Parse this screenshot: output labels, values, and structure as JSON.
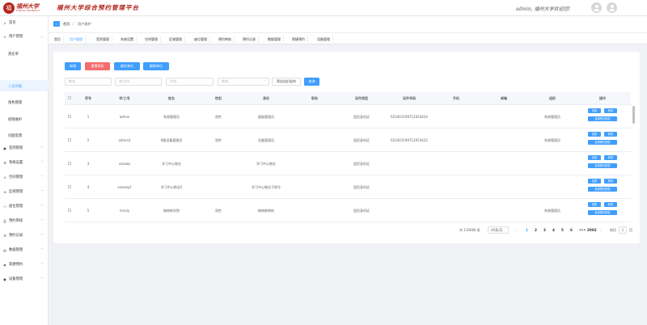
{
  "header": {
    "logo_mark": "福",
    "logo_cn": "福州大学",
    "logo_en": "FUZHOU UNIVERSITY",
    "system_title": "福州大学综合预约管理平台",
    "welcome": "admin, 福州大学欢迎您!"
  },
  "sidebar": {
    "items": [
      {
        "label": "首页",
        "icon": "home-icon"
      },
      {
        "label": "用户管理",
        "icon": "user-icon"
      },
      {
        "label": "签到管理",
        "icon": "person-icon"
      },
      {
        "label": "系统设置",
        "icon": "gear-icon"
      },
      {
        "label": "空间管理",
        "icon": "space-icon"
      },
      {
        "label": "区域管理",
        "icon": "region-icon"
      },
      {
        "label": "座位管理",
        "icon": "seat-icon"
      },
      {
        "label": "预约审核",
        "icon": "audit-icon"
      },
      {
        "label": "预约记录",
        "icon": "record-icon"
      },
      {
        "label": "数据管理",
        "icon": "data-icon"
      },
      {
        "label": "简捷预约",
        "icon": "quick-icon"
      },
      {
        "label": "设备管理",
        "icon": "device-icon"
      }
    ],
    "subitems": [
      "黑名单",
      "人员列表",
      "角色管理",
      "权限维护",
      "问题反馈"
    ]
  },
  "breadcrumb": {
    "home": "首页",
    "sep": "/",
    "current": "用户维护"
  },
  "tabs": [
    "首页",
    "用户管理",
    "签到管理",
    "系统设置",
    "空间管理",
    "区域管理",
    "座位管理",
    "预约审核",
    "预约记录",
    "数据管理",
    "简捷预约",
    "设备管理"
  ],
  "toolbar": {
    "add": "新增",
    "reset_password": "重置密码",
    "bind_org": "绑定单位",
    "unbind_org": "解绑单位"
  },
  "filters": {
    "name_placeholder": "姓名",
    "id_placeholder": "学/工号",
    "phone_placeholder": "手机",
    "gender_placeholder": "性别",
    "org_button": "筛选组织架构",
    "search_button": "查询"
  },
  "table": {
    "headers": [
      "序号",
      "学/工号",
      "姓名",
      "性别",
      "身份",
      "职务",
      "证件类型",
      "证件号码",
      "手机",
      "邮箱",
      "组织",
      "操作"
    ],
    "rows": [
      {
        "no": "1",
        "id": "admin",
        "name": "系统管理员",
        "gender": "男性",
        "role": "超级管理员",
        "title": "",
        "doc_type": "居民身份证",
        "doc_no": "623401199712054424",
        "phone": "",
        "email": "",
        "org": "系统管理员"
      },
      {
        "no": "2",
        "id": "admin2",
        "name": "8楼设备管理员",
        "gender": "男性",
        "role": "设备管理员",
        "title": "",
        "doc_type": "居民身份证",
        "doc_no": "623401199712054422",
        "phone": "",
        "email": "",
        "org": "系统管理员"
      },
      {
        "no": "3",
        "id": "xxzxwy",
        "name": "学习中心物业",
        "gender": "",
        "role": "学习中心物业",
        "title": "",
        "doc_type": "居民身份证",
        "doc_no": "",
        "phone": "",
        "email": "",
        "org": ""
      },
      {
        "no": "4",
        "id": "xxzxwy2",
        "name": "学习中心物业2",
        "gender": "",
        "role": "学习中心物业子账号",
        "title": "",
        "doc_type": "居民身份证",
        "doc_no": "",
        "phone": "",
        "email": "",
        "org": ""
      },
      {
        "no": "5",
        "id": "mnxly",
        "name": "梅南新学院",
        "gender": "男性",
        "role": "梅南新审核",
        "title": "",
        "doc_type": "居民身份证",
        "doc_no": "",
        "phone": "",
        "email": "",
        "org": "系统管理员"
      }
    ],
    "op_view": "查看",
    "op_edit": "修改",
    "op_bind": "批绑预约授权"
  },
  "pagination": {
    "total": "共 110080 条",
    "page_size": "40条/页",
    "prev": "‹",
    "pages": [
      "1",
      "2",
      "3",
      "4",
      "5",
      "6",
      "•••",
      "2002"
    ],
    "next": "›",
    "goto_label": "前往",
    "goto_value": "1",
    "goto_unit": "页"
  },
  "colors": {
    "primary": "#409eff",
    "danger": "#f56c6c",
    "brand": "#b3261e"
  }
}
